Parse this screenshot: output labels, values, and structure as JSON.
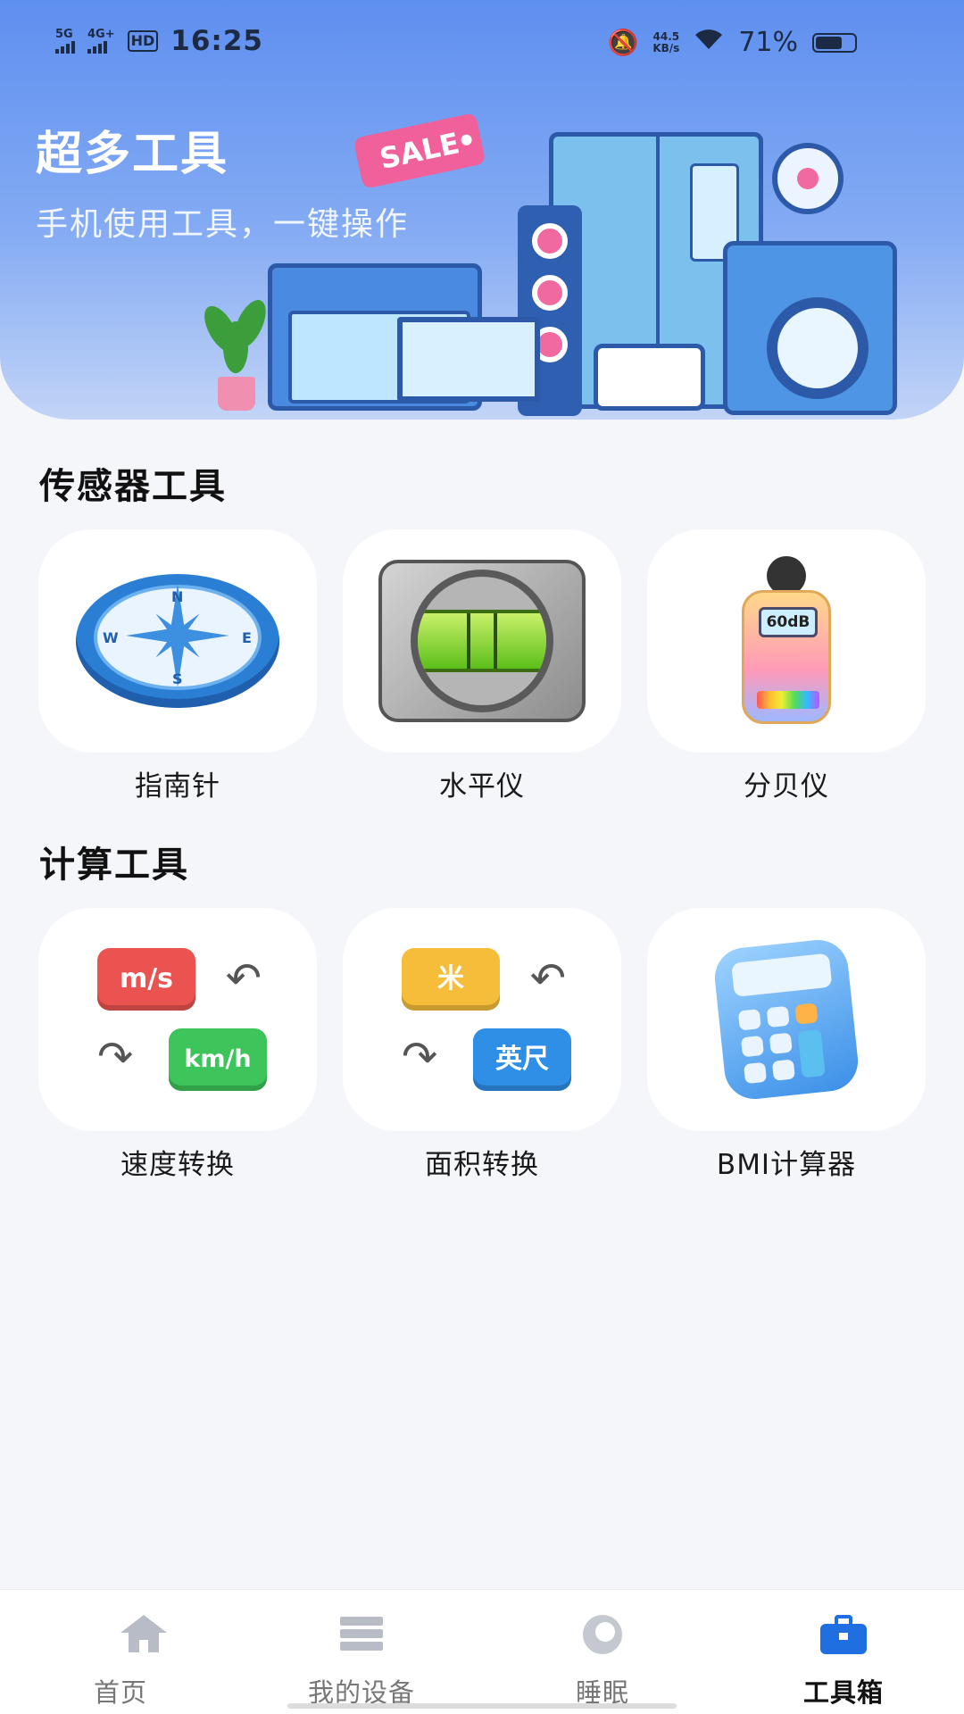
{
  "status_bar": {
    "network1": "5G",
    "network2": "4G+",
    "hd": "HD",
    "time": "16:25",
    "speed_value": "44.5",
    "speed_unit": "KB/s",
    "battery": "71%"
  },
  "banner": {
    "title": "超多工具",
    "subtitle": "手机使用工具，一键操作",
    "sale_tag": "SALE",
    "background_color": "#6f9df1"
  },
  "sections": [
    {
      "title": "传感器工具",
      "tools": [
        {
          "label": "指南针",
          "icon": "compass-icon"
        },
        {
          "label": "水平仪",
          "icon": "spirit-level-icon"
        },
        {
          "label": "分贝仪",
          "icon": "decibel-meter-icon",
          "display": "60dB"
        }
      ]
    },
    {
      "title": "计算工具",
      "tools": [
        {
          "label": "速度转换",
          "icon": "speed-convert-icon",
          "from": "m/s",
          "to": "km/h"
        },
        {
          "label": "面积转换",
          "icon": "area-convert-icon",
          "from": "米",
          "to": "英尺"
        },
        {
          "label": "BMI计算器",
          "icon": "calculator-icon"
        }
      ]
    }
  ],
  "bottom_nav": {
    "items": [
      {
        "label": "首页",
        "icon": "home-icon",
        "active": false
      },
      {
        "label": "我的设备",
        "icon": "devices-icon",
        "active": false
      },
      {
        "label": "睡眠",
        "icon": "sleep-icon",
        "active": false
      },
      {
        "label": "工具箱",
        "icon": "toolbox-icon",
        "active": true
      }
    ],
    "active_color": "#1f6fe0"
  }
}
